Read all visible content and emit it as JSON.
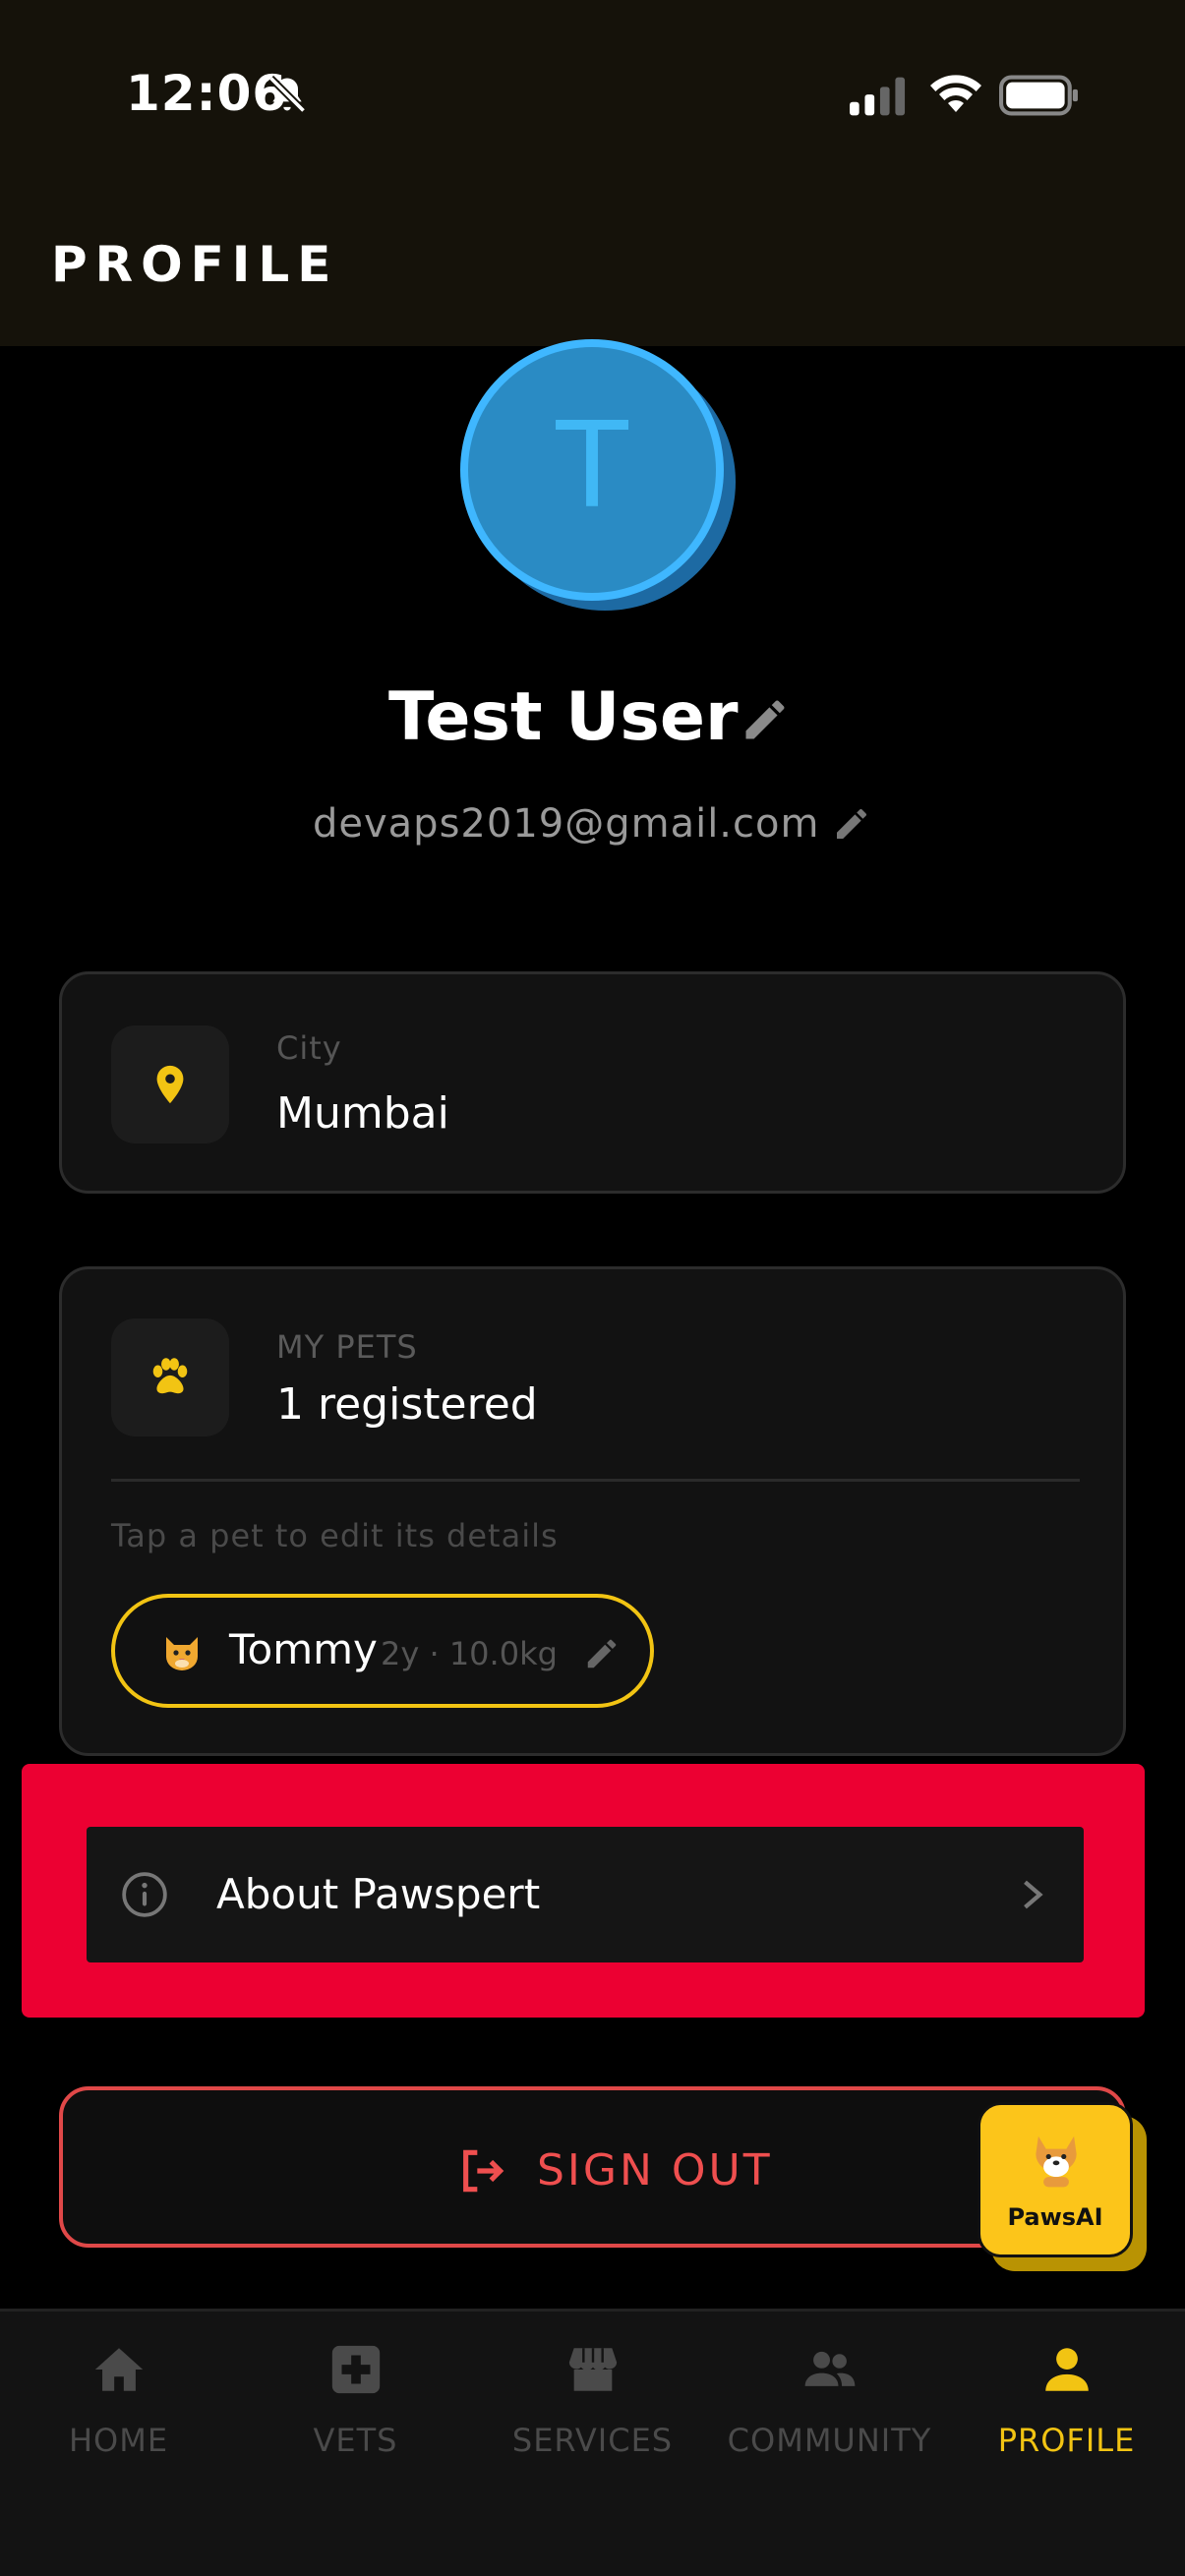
{
  "status_bar": {
    "time": "12:06"
  },
  "header": {
    "title": "PROFILE"
  },
  "profile": {
    "avatar_initial": "T",
    "name": "Test User",
    "email": "devaps2019@gmail.com"
  },
  "city_card": {
    "label": "City",
    "value": "Mumbai"
  },
  "pets_card": {
    "label": "MY PETS",
    "count_text": "1 registered",
    "hint": "Tap a pet to edit its details",
    "pets": [
      {
        "name": "Tommy",
        "meta": "2y · 10.0kg"
      }
    ]
  },
  "about": {
    "label": "About Pawspert"
  },
  "sign_out": {
    "label": "SIGN OUT"
  },
  "fab": {
    "label": "PawsAI"
  },
  "tabs": [
    {
      "label": "HOME",
      "icon": "home-icon"
    },
    {
      "label": "VETS",
      "icon": "medical-cross-icon"
    },
    {
      "label": "SERVICES",
      "icon": "storefront-icon"
    },
    {
      "label": "COMMUNITY",
      "icon": "people-icon"
    },
    {
      "label": "PROFILE",
      "icon": "person-icon"
    }
  ],
  "colors": {
    "accent": "#f2c413",
    "danger": "#ef4f4f",
    "avatar": "#2a8bc4",
    "highlight": "#ec0032"
  }
}
